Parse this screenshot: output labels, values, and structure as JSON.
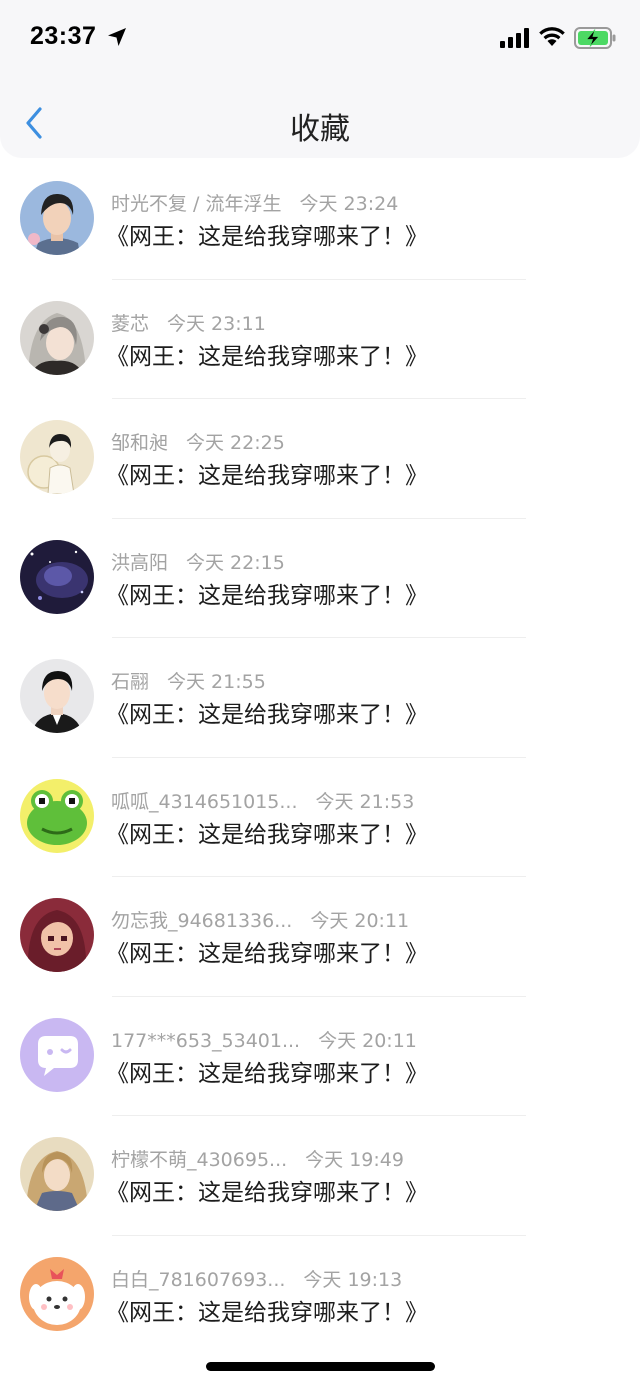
{
  "status_bar": {
    "time": "23:37"
  },
  "nav": {
    "title": "收藏"
  },
  "items": [
    {
      "name": "时光不复 / 流年浮生",
      "time": "今天 23:24",
      "content": "《网王：这是给我穿哪来了！》",
      "avatar": "avatar-young-man-blue"
    },
    {
      "name": "菱芯",
      "time": "今天 23:11",
      "content": "《网王：这是给我穿哪来了！》",
      "avatar": "avatar-anime-girl"
    },
    {
      "name": "邹和昶",
      "time": "今天 22:25",
      "content": "《网王：这是给我穿哪来了！》",
      "avatar": "avatar-sketch-boy"
    },
    {
      "name": "洪高阳",
      "time": "今天 22:15",
      "content": "《网王：这是给我穿哪来了！》",
      "avatar": "avatar-night-sky"
    },
    {
      "name": "石翮",
      "time": "今天 21:55",
      "content": "《网王：这是给我穿哪来了！》",
      "avatar": "avatar-man-suit"
    },
    {
      "name": "呱呱_4314651015...",
      "time": "今天 21:53",
      "content": "《网王：这是给我穿哪来了！》",
      "avatar": "avatar-pixel-frog"
    },
    {
      "name": "勿忘我_94681336...",
      "time": "今天 20:11",
      "content": "《网王：这是给我穿哪来了！》",
      "avatar": "avatar-pixel-girl"
    },
    {
      "name": "177***653_53401...",
      "time": "今天 20:11",
      "content": "《网王：这是给我穿哪来了！》",
      "avatar": "avatar-chat-bubble"
    },
    {
      "name": "柠檬不萌_430695...",
      "time": "今天 19:49",
      "content": "《网王：这是给我穿哪来了！》",
      "avatar": "avatar-anime-warrior"
    },
    {
      "name": "白白_781607693...",
      "time": "今天 19:13",
      "content": "《网王：这是给我穿哪来了！》",
      "avatar": "avatar-cartoon-dog"
    }
  ],
  "colors": {
    "nav_bg": "#f7f7f9",
    "back_arrow": "#3d8fe0",
    "meta_text": "#a3a3a3",
    "battery_fill": "#4cd964"
  }
}
